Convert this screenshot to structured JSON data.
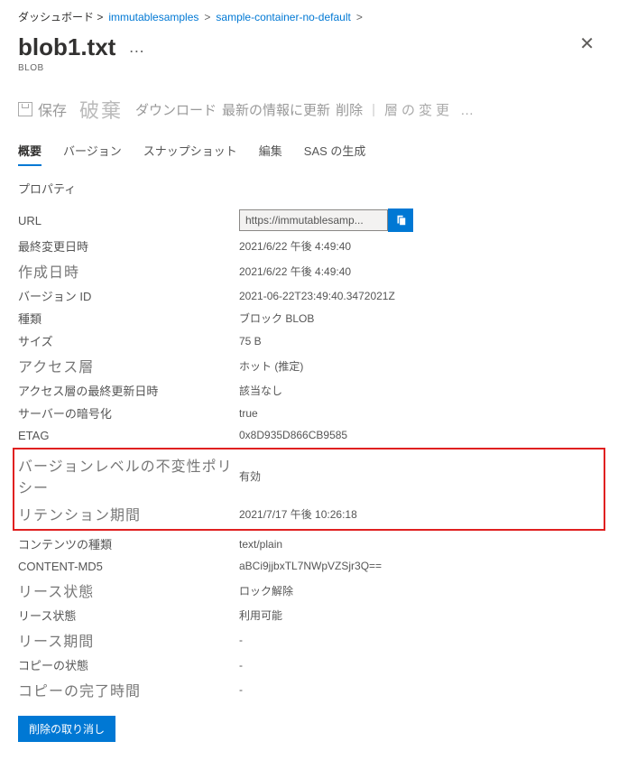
{
  "breadcrumb": {
    "root": "ダッシュボード >",
    "account": "immutablesamples",
    "container": "sample-container-no-default"
  },
  "header": {
    "title": "blob1.txt",
    "subtitle": "BLOB"
  },
  "toolbar": {
    "save": "保存",
    "discard": "破棄",
    "download": "ダウンロード",
    "refresh": "最新の情報に更新",
    "delete": "削除",
    "change_tier": "層の変更 …"
  },
  "tabs": {
    "overview": "概要",
    "versions": "バージョン",
    "snapshots": "スナップショット",
    "edit": "編集",
    "generate_sas": "SAS の生成"
  },
  "section": {
    "properties": "プロパティ"
  },
  "props": {
    "url_label": "URL",
    "url_value": "https://immutablesamp...",
    "last_modified_label": "最終変更日時",
    "last_modified_value": "2021/6/22 午後 4:49:40",
    "created_label": "作成日時",
    "created_value": "2021/6/22 午後 4:49:40",
    "version_id_label": "バージョン ID",
    "version_id_value": "2021-06-22T23:49:40.3472021Z",
    "type_label": "種類",
    "type_value": "ブロック BLOB",
    "size_label": "サイズ",
    "size_value": "75 B",
    "access_tier_label": "アクセス層",
    "access_tier_value": "ホット (推定)",
    "access_tier_updated_label": "アクセス層の最終更新日時",
    "access_tier_updated_value": "該当なし",
    "server_encrypted_label": "サーバーの暗号化",
    "server_encrypted_value": "true",
    "etag_label": "ETAG",
    "etag_value": "0x8D935D866CB9585",
    "immutability_label": "バージョンレベルの不変性ポリシー",
    "immutability_value": "有効",
    "retention_label": "リテンション期間",
    "retention_value": "2021/7/17 午後 10:26:18",
    "content_type_label": "コンテンツの種類",
    "content_type_value": "text/plain",
    "md5_label": "CONTENT-MD5",
    "md5_value": "aBCi9jjbxTL7NWpVZSjr3Q==",
    "lease_status_label": "リース状態",
    "lease_status_value": "ロック解除",
    "lease_state_label": "リース状態",
    "lease_state_value": "利用可能",
    "lease_duration_label": "リース期間",
    "lease_duration_value": "-",
    "copy_status_label": "コピーの状態",
    "copy_status_value": "-",
    "copy_completion_label": "コピーの完了時間",
    "copy_completion_value": "-"
  },
  "buttons": {
    "undelete": "削除の取り消し"
  }
}
